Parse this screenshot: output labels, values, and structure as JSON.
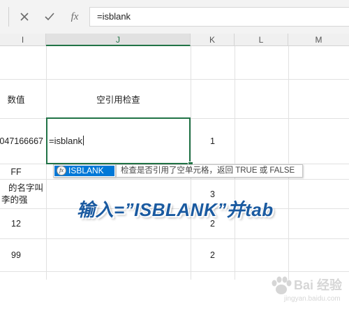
{
  "formula_bar": {
    "cancel_icon": "close-icon",
    "enter_icon": "check-icon",
    "fx_label": "fx",
    "content": "=isblank"
  },
  "columns": {
    "i": "I",
    "j": "J",
    "k": "K",
    "l": "L",
    "m": "M"
  },
  "cells": {
    "i_header": "数值",
    "j_header": "空引用检查",
    "i_row1": "047166667",
    "j_row1": "=isblank",
    "k_row1": "1",
    "i_row2": "FF",
    "i_row3_line1": "的名字叫",
    "i_row3_line2": "李的强",
    "k_row3": "3",
    "i_row4": "12",
    "k_row4": "2",
    "i_row5": "99",
    "k_row5": "2"
  },
  "autocomplete": {
    "fx_icon": "fx",
    "item": "ISBLANK",
    "tooltip": "检查是否引用了空单元格，返回 TRUE 或 FALSE"
  },
  "overlay_caption": "输入=”ISBLANK”并tab",
  "watermark": {
    "text": "Bai 经验",
    "url": "jingyan.baidu.com"
  },
  "colors": {
    "accent": "#217346",
    "selection": "#0078d7",
    "caption": "#1a5aa0"
  }
}
